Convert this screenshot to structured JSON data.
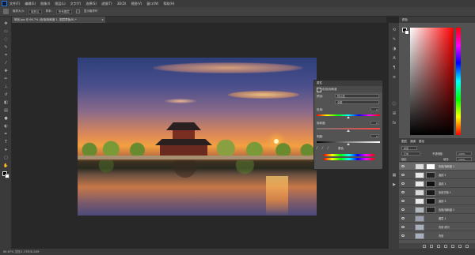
{
  "menubar": {
    "items": [
      "文件(F)",
      "编辑(E)",
      "图像(I)",
      "图层(L)",
      "文字(Y)",
      "选择(S)",
      "滤镜(T)",
      "3D(D)",
      "视图(V)",
      "窗口(W)",
      "帮助(H)"
    ]
  },
  "options": {
    "sample_label": "取样大小:",
    "sample_value": "取样点",
    "sample2_label": "样本:",
    "sample2_value": "所有图层",
    "ring_label": "显示取样环"
  },
  "document": {
    "tab_title": "故宫.jpg @ 66.7% (色相/饱和度 1, 图层蒙版/8) *",
    "close_glyph": "×"
  },
  "properties_panel": {
    "title": "属性",
    "subtitle": "色相/饱和度",
    "preset_label": "预设:",
    "preset_value": "默认值",
    "channel_value": "全图",
    "hue_label": "色相:",
    "hue_value": "0",
    "saturation_label": "饱和度:",
    "saturation_value": "0",
    "lightness_label": "明度:",
    "lightness_value": "0",
    "colorize_label": "着色"
  },
  "color_panel": {
    "title": "颜色",
    "fg_color": "#000000",
    "bg_color": "#ffffff"
  },
  "layers_panel": {
    "tabs": [
      "图层",
      "通道",
      "路径"
    ],
    "kind_label": "类型",
    "blend_mode": "正常",
    "opacity_label": "不透明度:",
    "opacity_value": "100%",
    "lock_label": "锁定:",
    "fill_label": "填充:",
    "fill_value": "100%",
    "layers": [
      {
        "name": "色相/饱和度 1",
        "thumb": "#dcdcdc",
        "mask": "#ffffff",
        "selected": true
      },
      {
        "name": "曲线 2",
        "thumb": "#e8e8e8",
        "mask": "#222222",
        "selected": false
      },
      {
        "name": "曲线 1",
        "thumb": "#e8e8e8",
        "mask": "#111111",
        "selected": false
      },
      {
        "name": "色彩平衡 1",
        "thumb": "#d8d8d8",
        "mask": "#1a1a1a",
        "selected": false
      },
      {
        "name": "曲线 3",
        "thumb": "#e8e8e8",
        "mask": "#111111",
        "selected": false
      },
      {
        "name": "色相/饱和度 2",
        "thumb": "#b0b8c0",
        "mask": "#222222",
        "selected": false
      },
      {
        "name": "图层 1",
        "thumb": "#9aa0b0",
        "mask": "",
        "selected": false
      },
      {
        "name": "背景 拷贝",
        "thumb": "#a8b0c0",
        "mask": "",
        "selected": false
      },
      {
        "name": "背景",
        "thumb": "#a8b0c0",
        "mask": "",
        "selected": false
      }
    ]
  },
  "status": {
    "text": "66.67%   文档:1.37M/8.24M"
  }
}
